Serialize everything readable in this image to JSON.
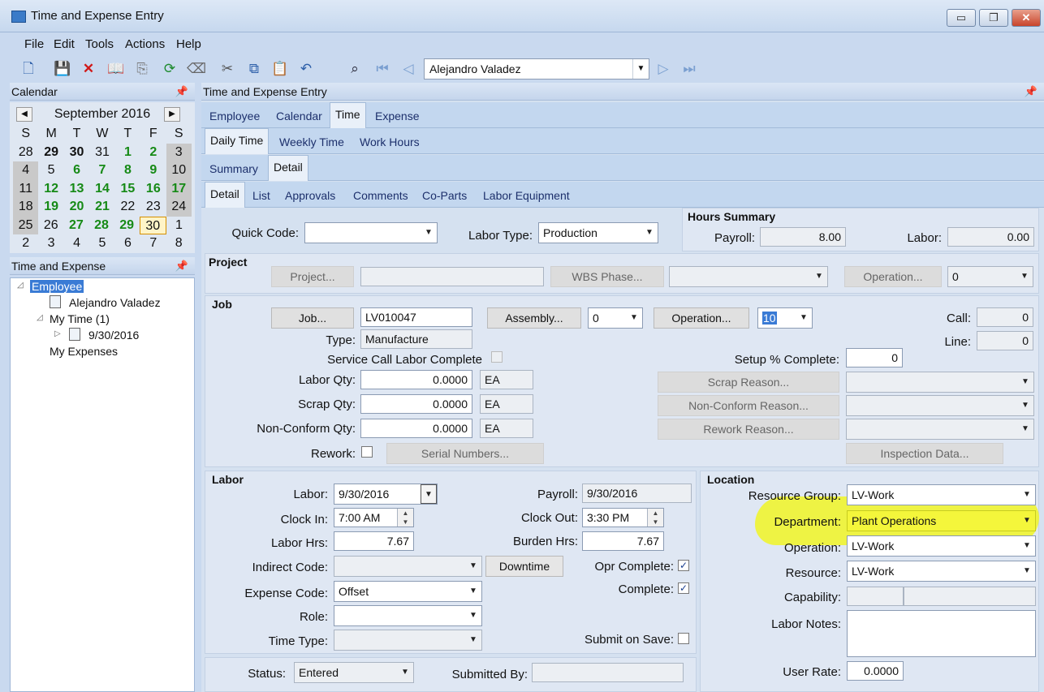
{
  "window": {
    "title": "Time and Expense Entry",
    "controls": {
      "minimize": "▭",
      "restore": "❐",
      "close": "✕"
    }
  },
  "menu": [
    "File",
    "Edit",
    "Tools",
    "Actions",
    "Help"
  ],
  "toolbar": {
    "employee_selector": "Alejandro Valadez"
  },
  "calendar_panel": {
    "title": "Calendar",
    "month": "September 2016",
    "weekdays": [
      "S",
      "M",
      "T",
      "W",
      "T",
      "F",
      "S"
    ],
    "weeks": [
      [
        "28",
        "29",
        "30",
        "31",
        "1",
        "2",
        "3"
      ],
      [
        "4",
        "5",
        "6",
        "7",
        "8",
        "9",
        "10"
      ],
      [
        "11",
        "12",
        "13",
        "14",
        "15",
        "16",
        "17"
      ],
      [
        "18",
        "19",
        "20",
        "21",
        "22",
        "23",
        "24"
      ],
      [
        "25",
        "26",
        "27",
        "28",
        "29",
        "30",
        "1"
      ],
      [
        "2",
        "3",
        "4",
        "5",
        "6",
        "7",
        "8"
      ]
    ],
    "selected": "30"
  },
  "tree_panel": {
    "title": "Time and Expense",
    "nodes": [
      "Employee",
      "Alejandro Valadez",
      "My Time (1)",
      "9/30/2016",
      "My Expenses"
    ]
  },
  "main": {
    "title": "Time and Expense Entry",
    "tabs1": [
      "Employee",
      "Calendar",
      "Time",
      "Expense"
    ],
    "tabs2": [
      "Daily Time",
      "Weekly Time",
      "Work Hours"
    ],
    "tabs3": [
      "Summary",
      "Detail"
    ],
    "tabs4": [
      "Detail",
      "List",
      "Approvals",
      "Comments",
      "Co-Parts",
      "Labor Equipment"
    ]
  },
  "top": {
    "quick_code_label": "Quick Code:",
    "quick_code": "",
    "labor_type_label": "Labor Type:",
    "labor_type": "Production",
    "hours_summary_title": "Hours Summary",
    "payroll_label": "Payroll:",
    "payroll": "8.00",
    "labor_label": "Labor:",
    "labor": "0.00"
  },
  "project": {
    "title": "Project",
    "project_btn": "Project...",
    "wbs_btn": "WBS Phase...",
    "operation_btn": "Operation...",
    "operation": "0"
  },
  "job": {
    "title": "Job",
    "job_btn": "Job...",
    "job": "LV010047",
    "assembly_btn": "Assembly...",
    "assembly": "0",
    "operation_btn": "Operation...",
    "operation": "10",
    "call_label": "Call:",
    "call": "0",
    "line_label": "Line:",
    "line": "0",
    "type_label": "Type:",
    "type": "Manufacture",
    "service_call_label": "Service Call Labor Complete",
    "setup_label": "Setup % Complete:",
    "setup": "0",
    "labor_qty_label": "Labor Qty:",
    "labor_qty": "0.0000",
    "labor_uom": "EA",
    "scrap_qty_label": "Scrap Qty:",
    "scrap_qty": "0.0000",
    "scrap_uom": "EA",
    "nonconform_qty_label": "Non-Conform Qty:",
    "nonconform_qty": "0.0000",
    "nonconform_uom": "EA",
    "scrap_reason_btn": "Scrap Reason...",
    "nonconform_reason_btn": "Non-Conform Reason...",
    "rework_reason_btn": "Rework Reason...",
    "rework_label": "Rework:",
    "serial_btn": "Serial Numbers...",
    "inspection_btn": "Inspection Data..."
  },
  "labor": {
    "title": "Labor",
    "labor_label": "Labor:",
    "labor_date": "9/30/2016",
    "payroll_label": "Payroll:",
    "payroll_date": "9/30/2016",
    "clock_in_label": "Clock In:",
    "clock_in": "7:00 AM",
    "clock_out_label": "Clock Out:",
    "clock_out": "3:30 PM",
    "labor_hrs_label": "Labor Hrs:",
    "labor_hrs": "7.67",
    "burden_hrs_label": "Burden Hrs:",
    "burden_hrs": "7.67",
    "indirect_label": "Indirect Code:",
    "downtime_btn": "Downtime",
    "opr_complete_label": "Opr Complete:",
    "complete_label": "Complete:",
    "expense_label": "Expense Code:",
    "expense_code": "Offset",
    "role_label": "Role:",
    "time_type_label": "Time Type:",
    "submit_label": "Submit on Save:"
  },
  "location": {
    "title": "Location",
    "resource_group_label": "Resource Group:",
    "resource_group": "LV-Work",
    "department_label": "Department:",
    "department": "Plant Operations",
    "operation_label": "Operation:",
    "operation": "LV-Work",
    "resource_label": "Resource:",
    "resource": "LV-Work",
    "capability_label": "Capability:",
    "labor_notes_label": "Labor Notes:",
    "user_rate_label": "User Rate:",
    "user_rate": "0.0000"
  },
  "status": {
    "status_label": "Status:",
    "status": "Entered",
    "submitted_label": "Submitted By:",
    "submitted_by": ""
  }
}
